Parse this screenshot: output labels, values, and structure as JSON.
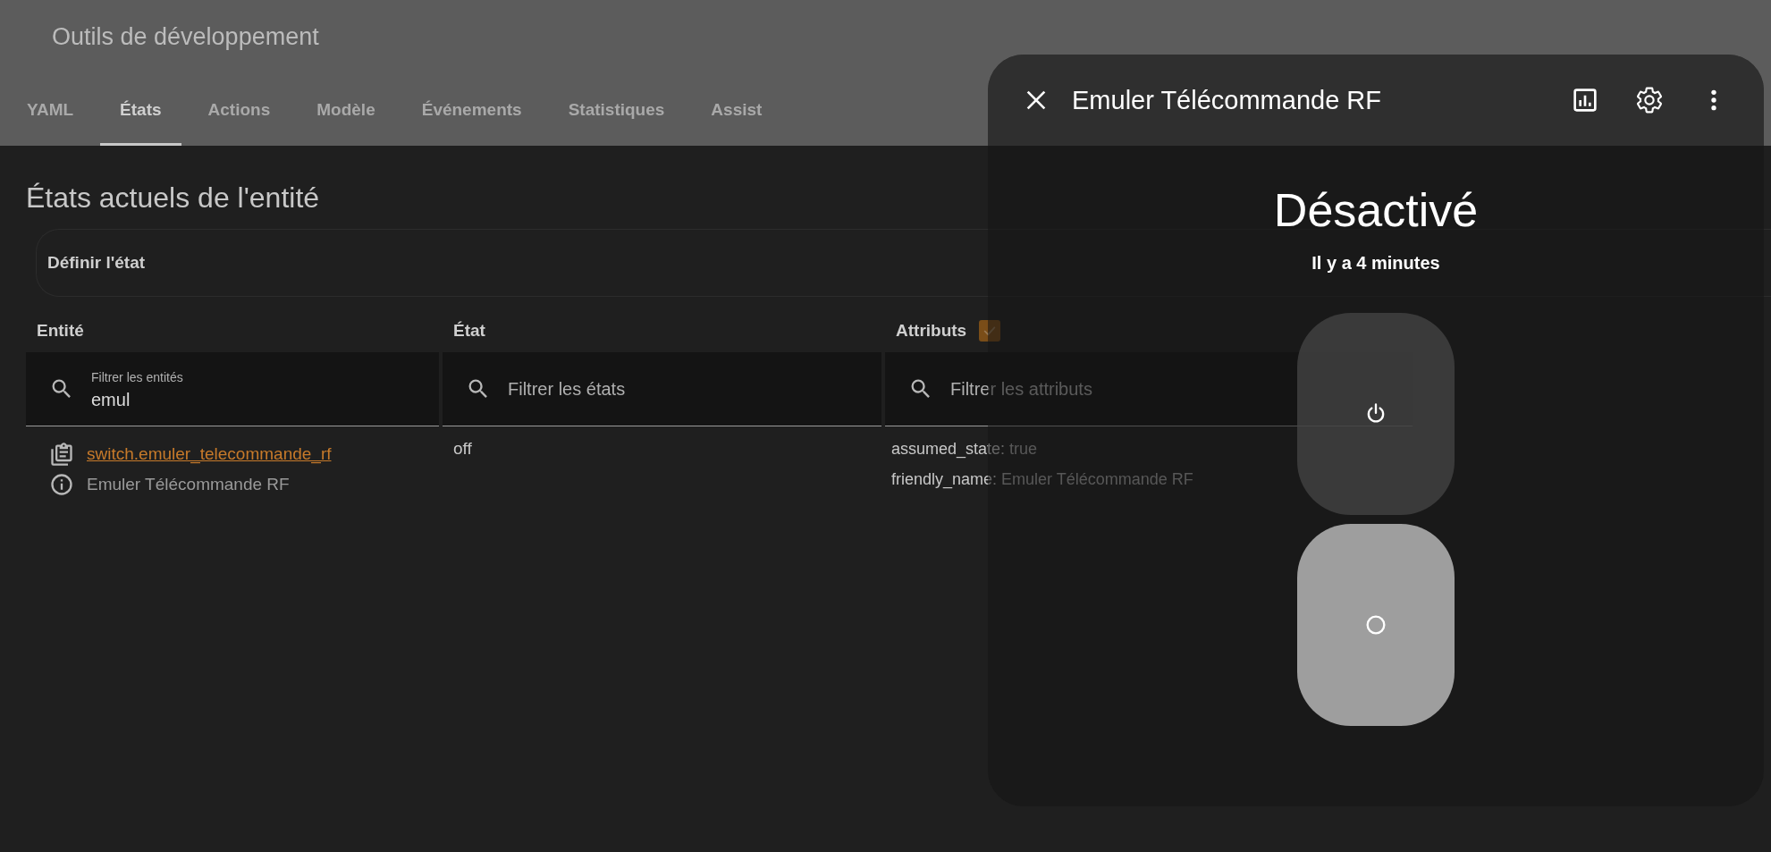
{
  "header": {
    "title": "Outils de développement"
  },
  "tabs": [
    {
      "label": "YAML",
      "selected": false
    },
    {
      "label": "États",
      "selected": true
    },
    {
      "label": "Actions",
      "selected": false
    },
    {
      "label": "Modèle",
      "selected": false
    },
    {
      "label": "Événements",
      "selected": false
    },
    {
      "label": "Statistiques",
      "selected": false
    },
    {
      "label": "Assist",
      "selected": false
    }
  ],
  "page": {
    "title": "États actuels de l'entité",
    "set_state": {
      "label": "Définir l'état"
    }
  },
  "table": {
    "columns": [
      {
        "label": "Entité"
      },
      {
        "label": "État"
      },
      {
        "label": "Attributs",
        "checkbox_checked": true
      }
    ],
    "filters": [
      {
        "label": "Filtrer les entités",
        "value": "emul"
      },
      {
        "placeholder": "Filtrer les états"
      },
      {
        "placeholder": "Filtrer les attributs"
      }
    ],
    "rows": [
      {
        "entity_id": "switch.emuler_telecommande_rf",
        "friendly_name": "Emuler Télécommande RF",
        "state": "off",
        "attributes": [
          {
            "key": "assumed_state:",
            "value": "true"
          },
          {
            "key": "friendly_name:",
            "value": "Emuler Télécommande RF"
          }
        ]
      }
    ]
  },
  "dialog": {
    "title": "Emuler Télécommande RF",
    "state": "Désactivé",
    "last_changed": "Il y a 4 minutes",
    "switch_on": false
  }
}
